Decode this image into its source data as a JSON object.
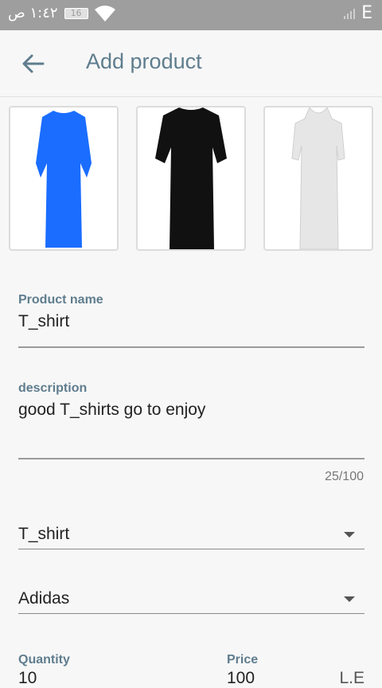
{
  "status_bar": {
    "time": "١:٤٢ ص",
    "battery": "16",
    "network": "E"
  },
  "app_bar": {
    "title": "Add product"
  },
  "product_images": [
    {
      "color": "#1a6dff",
      "label": "blue-thobe"
    },
    {
      "color": "#111111",
      "label": "black-thobe"
    },
    {
      "color": "#e6e6e6",
      "label": "white-thobe"
    }
  ],
  "form": {
    "product_name": {
      "label": "Product name",
      "value": "T_shirt"
    },
    "description": {
      "label": "description",
      "value": "good T_shirts go to enjoy",
      "counter": "25/100"
    },
    "category": {
      "selected": "T_shirt"
    },
    "brand": {
      "selected": "Adidas"
    },
    "quantity": {
      "label": "Quantity",
      "value": "10"
    },
    "price": {
      "label": "Price",
      "value": "100",
      "suffix": "L.E"
    }
  },
  "colors": {
    "accent": "#5f7d8e",
    "status_bar": "#9e9e9e",
    "background": "#f7f7f7"
  }
}
